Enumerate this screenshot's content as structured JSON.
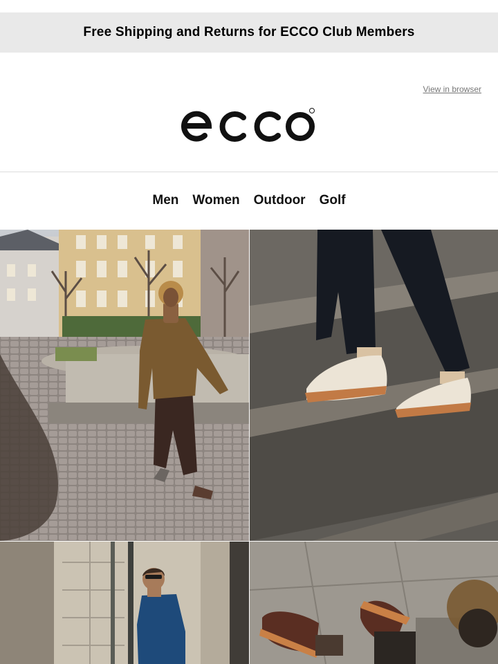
{
  "promo": {
    "text": "Free Shipping and Returns for ECCO Club Members"
  },
  "header": {
    "view_in_browser": "View in browser",
    "logo_alt": "ecco"
  },
  "nav": {
    "items": [
      "Men",
      "Women",
      "Outdoor",
      "Golf"
    ]
  },
  "colors": {
    "promo_bg": "#e9e9e9",
    "text": "#000000",
    "link_gray": "#777777",
    "divider": "#dcdcdc"
  },
  "images": [
    {
      "name": "hero-woman-walking-plaza"
    },
    {
      "name": "sneakers-on-stone-steps"
    },
    {
      "name": "man-blue-sweater-stone-wall"
    },
    {
      "name": "brown-shoes-on-pavement"
    }
  ]
}
